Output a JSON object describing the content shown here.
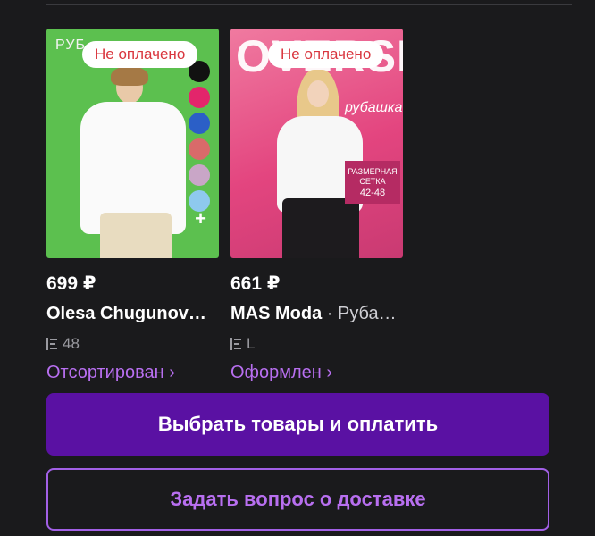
{
  "products": [
    {
      "badge": "Не оплачено",
      "bg_word": "РУБ",
      "price": "699 ₽",
      "seller": "Olesa Chugunov…",
      "subtitle": "",
      "size": "48",
      "status": "Отсортирован ›",
      "swatches": [
        "#111111",
        "#e3256b",
        "#2b5fc7",
        "#d96a6a",
        "#c9a6c7",
        "#8ec9ee"
      ],
      "plus": "+"
    },
    {
      "badge": "Не оплачено",
      "bg_big": "OVERSIZE",
      "bg_script": "рубашка",
      "size_tag": [
        "РАЗМЕРНАЯ",
        "СЕТКА",
        "42-48"
      ],
      "price": "661 ₽",
      "seller": "MAS Moda",
      "subtitle": " · Руба…",
      "size": "L",
      "status": "Оформлен ›"
    }
  ],
  "actions": {
    "primary": "Выбрать товары и оплатить",
    "secondary": "Задать вопрос о доставке"
  },
  "colors": {
    "accent": "#5a11a3",
    "status_link": "#b86ff0",
    "badge_text": "#d9363e",
    "background": "#1a1a1c"
  }
}
